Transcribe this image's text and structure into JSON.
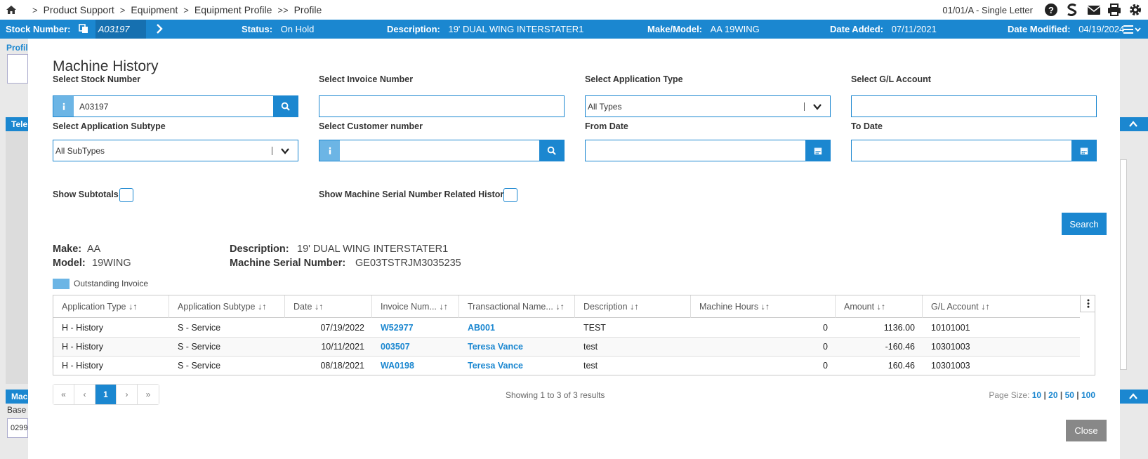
{
  "breadcrumb": {
    "items": [
      "Product Support",
      "Equipment",
      "Equipment Profile",
      "Profile"
    ],
    "separators": [
      ">",
      ">",
      ">",
      ">>"
    ]
  },
  "user": {
    "label": "01/01/A - Single Letter"
  },
  "infobar": {
    "stock_label": "Stock Number:",
    "stock_value": "A03197",
    "status_label": "Status:",
    "status_value": "On Hold",
    "desc_label": "Description:",
    "desc_value": "19' DUAL WING INTERSTATER1",
    "make_label": "Make/Model:",
    "make_value": "AA 19WING",
    "added_label": "Date Added:",
    "added_value": "07/11/2021",
    "modified_label": "Date Modified:",
    "modified_value": "04/19/2024"
  },
  "background": {
    "profile_tab": "Profil",
    "tele_tab": "Tele",
    "mac_tab": "Mac",
    "base_label": "Base",
    "base_value": "0299"
  },
  "modal": {
    "title": "Machine History",
    "filters": {
      "stock_label": "Select Stock Number",
      "stock_value": "A03197",
      "invoice_label": "Select Invoice Number",
      "invoice_value": "",
      "apptype_label": "Select Application Type",
      "apptype_value": "All Types",
      "gl_label": "Select G/L Account",
      "gl_value": "",
      "subtype_label": "Select Application Subtype",
      "subtype_value": "All SubTypes",
      "customer_label": "Select Customer number",
      "customer_value": "",
      "from_label": "From Date",
      "from_value": "",
      "to_label": "To Date",
      "to_value": ""
    },
    "subtotals_label": "Show Subtotals",
    "serial_history_label": "Show Machine Serial Number Related History",
    "search_label": "Search",
    "machine": {
      "make_label": "Make:",
      "make_value": "AA",
      "model_label": "Model:",
      "model_value": "19WING",
      "desc_label": "Description:",
      "desc_value": "19' DUAL WING INTERSTATER1",
      "serial_label": "Machine Serial Number:",
      "serial_value": "GE03TSTRJM3035235"
    },
    "legend_label": "Outstanding Invoice",
    "legend_color": "#6cb5e5",
    "grid": {
      "columns": [
        "Application Type ↓↑",
        "Application Subtype ↓↑",
        "Date ↓↑",
        "Invoice Num... ↓↑",
        "Transactional Name... ↓↑",
        "Description ↓↑",
        "Machine Hours ↓↑",
        "Amount ↓↑",
        "G/L Account ↓↑"
      ],
      "rows": [
        {
          "type": "H - History",
          "subtype": "S - Service",
          "date": "07/19/2022",
          "invoice": "W52977",
          "name": "AB001",
          "desc": "TEST",
          "hours": "0",
          "amount": "1136.00",
          "gl": "10101001"
        },
        {
          "type": "H - History",
          "subtype": "S - Service",
          "date": "10/11/2021",
          "invoice": "003507",
          "name": "Teresa Vance",
          "desc": "test",
          "hours": "0",
          "amount": "-160.46",
          "gl": "10301003"
        },
        {
          "type": "H - History",
          "subtype": "S - Service",
          "date": "08/18/2021",
          "invoice": "WA0198",
          "name": "Teresa Vance",
          "desc": "test",
          "hours": "0",
          "amount": "160.46",
          "gl": "10301003"
        }
      ]
    },
    "pager": {
      "first": "«",
      "prev": "‹",
      "current": "1",
      "next": "›",
      "last": "»",
      "showing": "Showing 1 to 3 of 3 results",
      "size_label": "Page Size:",
      "sizes": [
        "10",
        "20",
        "50",
        "100"
      ]
    },
    "close_label": "Close"
  },
  "colors": {
    "accent": "#1b87d0",
    "accent_light": "#6cb5e5",
    "close_btn": "#888888"
  }
}
